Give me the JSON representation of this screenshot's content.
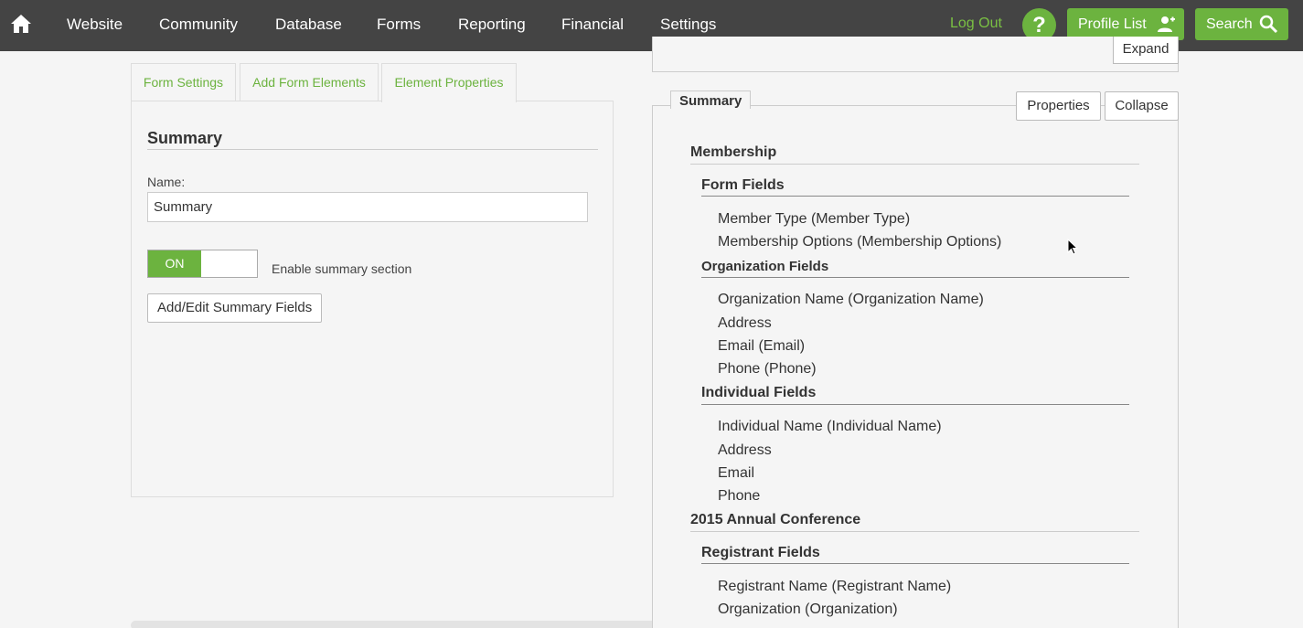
{
  "nav": {
    "items": [
      "Website",
      "Community",
      "Database",
      "Forms",
      "Reporting",
      "Financial",
      "Settings"
    ],
    "logout": "Log Out",
    "help": "?",
    "profile_list": "Profile List",
    "search": "Search"
  },
  "left": {
    "tabs": [
      "Form Settings",
      "Add Form Elements",
      "Element Properties"
    ],
    "active_tab": "Element Properties",
    "title": "Summary",
    "name_label": "Name:",
    "name_value": "Summary",
    "toggle_state": "ON",
    "toggle_label": "Enable summary section",
    "add_edit_button": "Add/Edit Summary Fields"
  },
  "right": {
    "expand_button": "Expand",
    "summary_tab": "Summary",
    "properties_button": "Properties",
    "collapse_button": "Collapse",
    "sections": [
      {
        "title": "Membership",
        "groups": [
          {
            "title": "Form Fields",
            "fields": [
              "Member Type (Member Type)",
              "Membership Options (Membership Options)"
            ]
          },
          {
            "title": "Organization Fields",
            "fields": [
              "Organization Name (Organization Name)",
              "Address",
              "Email (Email)",
              "Phone (Phone)"
            ]
          },
          {
            "title": "Individual Fields",
            "fields": [
              "Individual Name (Individual Name)",
              "Address",
              "Email",
              "Phone"
            ]
          }
        ]
      },
      {
        "title": "2015 Annual Conference",
        "groups": [
          {
            "title": "Registrant Fields",
            "fields": [
              "Registrant Name (Registrant Name)",
              "Organization (Organization)"
            ]
          }
        ]
      }
    ]
  },
  "colors": {
    "accent": "#6cb33f",
    "nav_bg": "#444444"
  },
  "icons": {
    "home": "home-icon",
    "help": "question-icon",
    "profile": "person-add-icon",
    "search": "search-icon"
  }
}
